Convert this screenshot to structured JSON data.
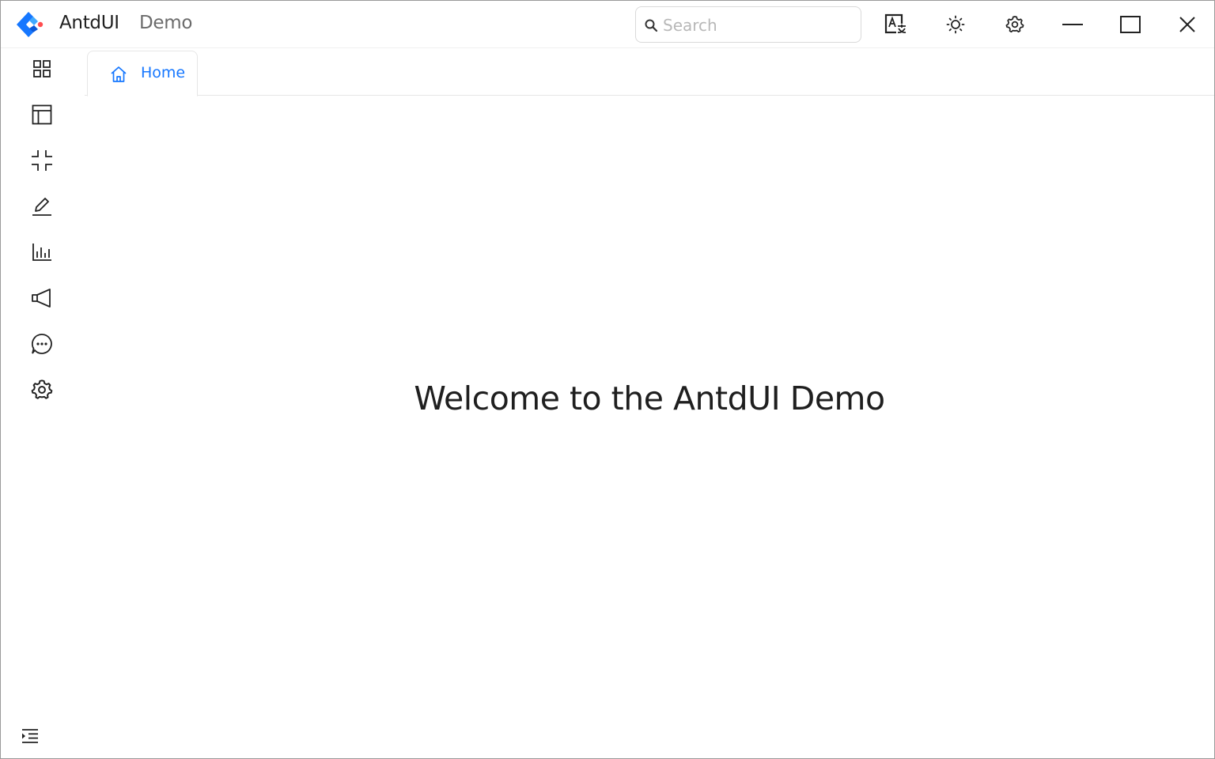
{
  "app": {
    "name": "AntdUI",
    "subtitle": "Demo"
  },
  "search": {
    "placeholder": "Search",
    "value": ""
  },
  "titlebar": {
    "buttons": [
      "translate-icon",
      "theme-sun-icon",
      "settings-gear-icon",
      "minimize-icon",
      "maximize-icon",
      "close-icon"
    ]
  },
  "sidebar": {
    "items": [
      {
        "icon": "appstore-icon"
      },
      {
        "icon": "layout-icon"
      },
      {
        "icon": "compress-icon"
      },
      {
        "icon": "edit-icon"
      },
      {
        "icon": "bar-chart-icon"
      },
      {
        "icon": "notification-icon"
      },
      {
        "icon": "message-icon"
      },
      {
        "icon": "setting-icon"
      }
    ],
    "collapse_icon": "menu-unfold-icon"
  },
  "tabs": [
    {
      "label": "Home",
      "icon": "home-icon",
      "active": true
    }
  ],
  "main": {
    "welcome": "Welcome to the AntdUI Demo"
  },
  "colors": {
    "accent": "#1677ff",
    "text": "#1f1f1f",
    "muted": "#6b6b6b",
    "border": "#d9d9d9"
  }
}
